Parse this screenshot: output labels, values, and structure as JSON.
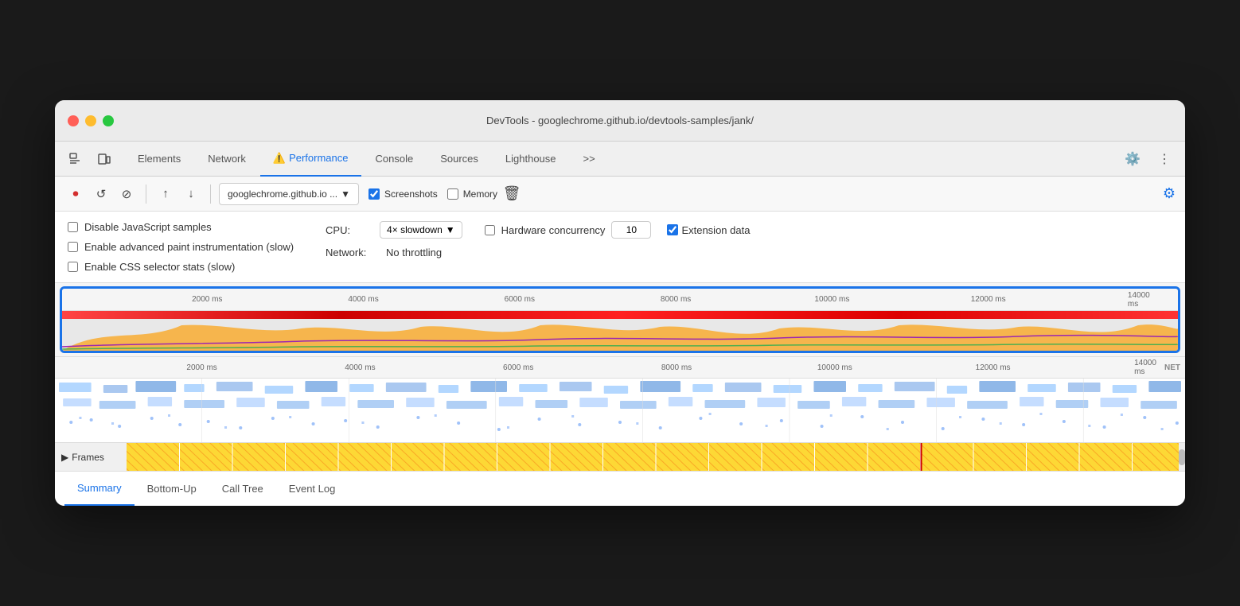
{
  "window": {
    "title": "DevTools - googlechrome.github.io/devtools-samples/jank/"
  },
  "tabs": {
    "items": [
      {
        "id": "elements",
        "label": "Elements",
        "active": false
      },
      {
        "id": "network",
        "label": "Network",
        "active": false
      },
      {
        "id": "performance",
        "label": "Performance",
        "active": true,
        "warning": true
      },
      {
        "id": "console",
        "label": "Console",
        "active": false
      },
      {
        "id": "sources",
        "label": "Sources",
        "active": false
      },
      {
        "id": "lighthouse",
        "label": "Lighthouse",
        "active": false
      },
      {
        "id": "more",
        "label": ">>",
        "active": false
      }
    ]
  },
  "toolbar": {
    "url_display": "googlechrome.github.io ...",
    "screenshots_label": "Screenshots",
    "memory_label": "Memory"
  },
  "options": {
    "disable_js_label": "Disable JavaScript samples",
    "advanced_paint_label": "Enable advanced paint instrumentation (slow)",
    "css_selector_label": "Enable CSS selector stats (slow)",
    "cpu_label": "CPU:",
    "cpu_value": "4× slowdown",
    "network_label": "Network:",
    "network_value": "No throttling",
    "hardware_concurrency_label": "Hardware concurrency",
    "hardware_concurrency_value": "10",
    "extension_data_label": "Extension data"
  },
  "timeline": {
    "ruler_marks": [
      "2000 ms",
      "4000 ms",
      "6000 ms",
      "8000 ms",
      "10000 ms",
      "12000 ms",
      "14000 ms"
    ],
    "net_label": "NET"
  },
  "frames": {
    "label": "Frames",
    "triangle": "▶"
  },
  "bottom_tabs": {
    "items": [
      {
        "id": "summary",
        "label": "Summary",
        "active": true
      },
      {
        "id": "bottom-up",
        "label": "Bottom-Up",
        "active": false
      },
      {
        "id": "call-tree",
        "label": "Call Tree",
        "active": false
      },
      {
        "id": "event-log",
        "label": "Event Log",
        "active": false
      }
    ]
  }
}
